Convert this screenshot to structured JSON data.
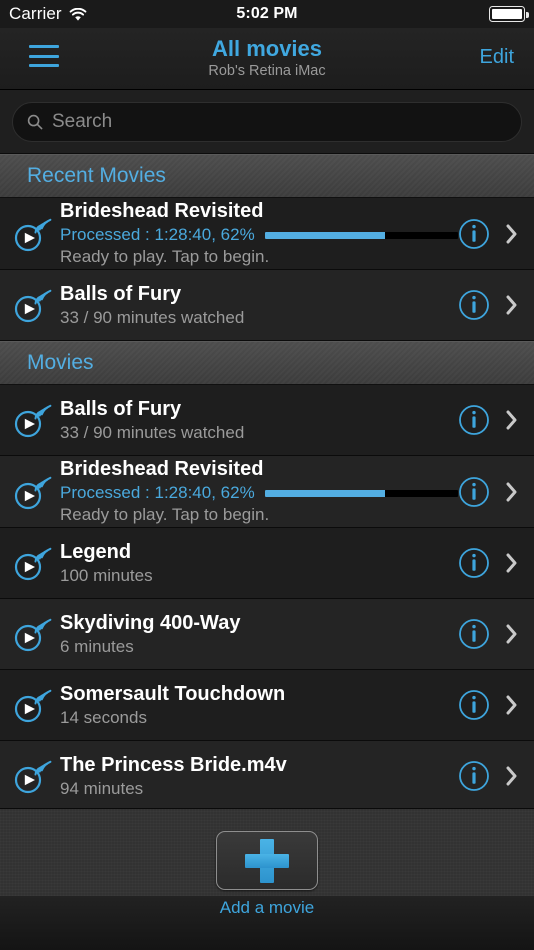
{
  "status_bar": {
    "carrier": "Carrier",
    "wifi_icon": "wifi-icon",
    "time": "5:02 PM",
    "battery_icon": "battery-full-icon"
  },
  "nav": {
    "menu_icon": "hamburger-menu-icon",
    "title": "All movies",
    "subtitle": "Rob's Retina iMac",
    "edit_label": "Edit"
  },
  "search": {
    "icon": "search-icon",
    "placeholder": "Search",
    "value": ""
  },
  "colors": {
    "accent_blue": "#3ea5dd",
    "title_blue": "#40a8e0",
    "section_blue": "#53aee2",
    "progress_fill": "#53aee2",
    "row_title": "#ffffff",
    "row_subtitle": "#9b9b9b",
    "row_bg": "#1e1e1e",
    "row_bg_alt": "#242424",
    "section_bg": "#444444"
  },
  "sections": [
    {
      "header": "Recent Movies",
      "rows": [
        {
          "play_icon": "play-stream-icon",
          "title": "Brideshead Revisited",
          "status": "Processed : 1:28:40, 62%",
          "progress_percent": 62,
          "subtitle": "Ready to play. Tap to begin.",
          "info_icon": "info-circle-icon",
          "disclosure_icon": "chevron-right-icon"
        },
        {
          "play_icon": "play-stream-icon",
          "title": "Balls of Fury",
          "subtitle": "33 / 90 minutes watched",
          "info_icon": "info-circle-icon",
          "disclosure_icon": "chevron-right-icon"
        }
      ]
    },
    {
      "header": "Movies",
      "rows": [
        {
          "play_icon": "play-stream-icon",
          "title": "Balls of Fury",
          "subtitle": "33 / 90 minutes watched",
          "info_icon": "info-circle-icon",
          "disclosure_icon": "chevron-right-icon"
        },
        {
          "play_icon": "play-stream-icon",
          "title": "Brideshead Revisited",
          "status": "Processed : 1:28:40, 62%",
          "progress_percent": 62,
          "subtitle": "Ready to play. Tap to begin.",
          "info_icon": "info-circle-icon",
          "disclosure_icon": "chevron-right-icon"
        },
        {
          "play_icon": "play-stream-icon",
          "title": "Legend",
          "subtitle": "100 minutes",
          "info_icon": "info-circle-icon",
          "disclosure_icon": "chevron-right-icon"
        },
        {
          "play_icon": "play-stream-icon",
          "title": "Skydiving 400-Way",
          "subtitle": "6 minutes",
          "info_icon": "info-circle-icon",
          "disclosure_icon": "chevron-right-icon"
        },
        {
          "play_icon": "play-stream-icon",
          "title": "Somersault Touchdown",
          "subtitle": "14 seconds",
          "info_icon": "info-circle-icon",
          "disclosure_icon": "chevron-right-icon"
        },
        {
          "play_icon": "play-stream-icon",
          "title": "The Princess Bride.m4v",
          "subtitle": "94 minutes",
          "info_icon": "info-circle-icon",
          "disclosure_icon": "chevron-right-icon"
        }
      ]
    }
  ],
  "footer": {
    "add_icon": "plus-icon",
    "add_label": "Add a movie"
  }
}
